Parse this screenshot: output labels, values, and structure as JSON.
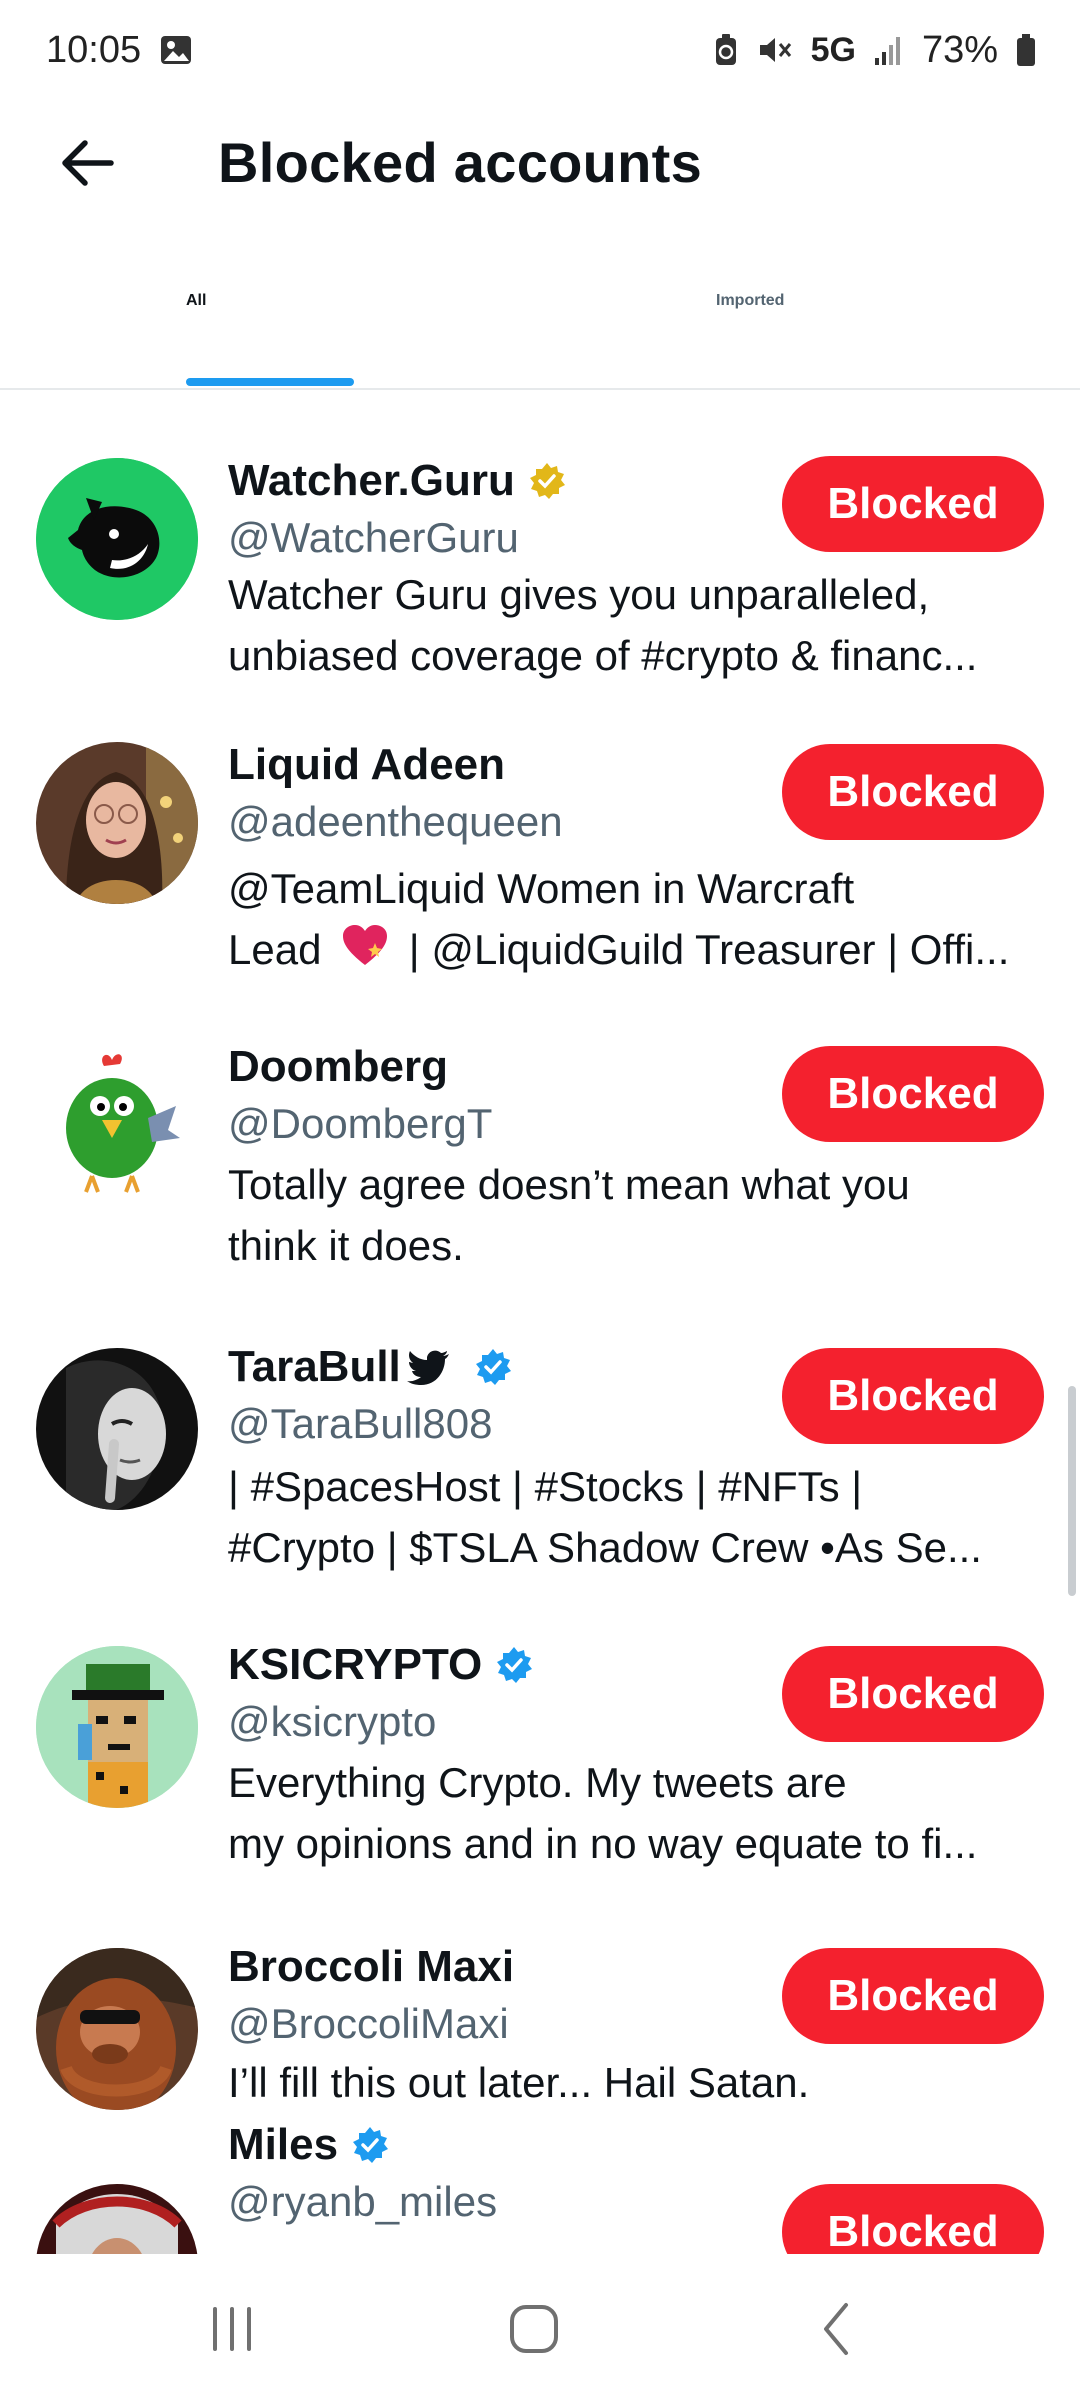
{
  "status": {
    "time": "10:05",
    "network": "5G",
    "battery": "73%"
  },
  "header": {
    "title": "Blocked accounts"
  },
  "tabs": {
    "all": "All",
    "imported": "Imported",
    "active": "All"
  },
  "colors": {
    "accent": "#1d9bf0",
    "blocked": "#f4212e",
    "secondary_text": "#536471",
    "verified_gold": "#e2b719"
  },
  "accounts": [
    {
      "name": "Watcher.Guru",
      "handle": "@WatcherGuru",
      "badge": "gold-verified-icon",
      "bio_line1": "Watcher Guru gives you unparalleled,",
      "bio_line2": "unbiased coverage of #crypto & financ...",
      "button": "Blocked"
    },
    {
      "name": "Liquid Adeen",
      "handle": "@adeenthequeen",
      "badge": "",
      "bio_line1": "@TeamLiquid Women in Warcraft",
      "bio_line2a": "Lead",
      "bio_line2b": "| @LiquidGuild Treasurer | Offi...",
      "button": "Blocked"
    },
    {
      "name": "Doomberg",
      "handle": "@DoombergT",
      "badge": "",
      "bio_line1": "Totally agree doesn’t mean what you",
      "bio_line2": "think it does.",
      "button": "Blocked"
    },
    {
      "name": "TaraBull",
      "handle": "@TaraBull808",
      "badge": "blue-verified-icon",
      "bio_line1": "| #SpacesHost | #Stocks | #NFTs |",
      "bio_line2": "#Crypto | $TSLA Shadow Crew •As Se...",
      "button": "Blocked"
    },
    {
      "name": "KSICRYPTO",
      "handle": "@ksicrypto",
      "badge": "blue-verified-icon",
      "bio_line1": "Everything Crypto. My tweets are",
      "bio_line2": "my opinions and in no way equate to fi...",
      "button": "Blocked"
    },
    {
      "name": "Broccoli Maxi",
      "handle": "@BroccoliMaxi",
      "badge": "",
      "bio_line1": "I’ll fill this out later... Hail Satan.",
      "button": "Blocked"
    },
    {
      "name": "Miles",
      "handle": "@ryanb_miles",
      "badge": "blue-verified-icon",
      "button": "Blocked"
    }
  ]
}
